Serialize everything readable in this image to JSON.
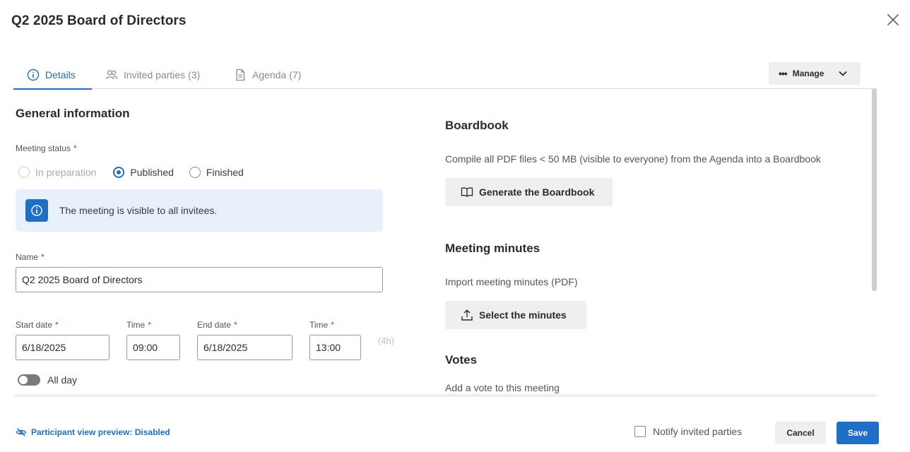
{
  "dialog": {
    "title": "Q2 2025 Board of Directors"
  },
  "tabs": [
    {
      "label": "Details",
      "icon": "info-icon",
      "active": true
    },
    {
      "label": "Invited parties (3)",
      "icon": "people-icon",
      "active": false
    },
    {
      "label": "Agenda (7)",
      "icon": "document-icon",
      "active": false
    }
  ],
  "manage": {
    "label": "Manage"
  },
  "general": {
    "heading": "General information",
    "status_label": "Meeting status",
    "required_mark": "*",
    "status_options": [
      {
        "label": "In preparation",
        "state": "disabled"
      },
      {
        "label": "Published",
        "state": "checked"
      },
      {
        "label": "Finished",
        "state": "unchecked"
      }
    ],
    "info_message": "The meeting is visible to all invitees.",
    "name_label": "Name",
    "name_value": "Q2 2025 Board of Directors",
    "start_date_label": "Start date",
    "start_date_value": "6/18/2025",
    "start_time_label": "Time",
    "start_time_value": "09:00",
    "end_date_label": "End date",
    "end_date_value": "6/18/2025",
    "end_time_label": "Time",
    "end_time_value": "13:00",
    "duration": "(4h)",
    "all_day_label": "All day",
    "all_day_on": false
  },
  "boardbook": {
    "heading": "Boardbook",
    "description": "Compile all PDF files < 50 MB (visible to everyone) from the Agenda into a Boardbook",
    "button_label": "Generate the Boardbook"
  },
  "minutes": {
    "heading": "Meeting minutes",
    "description": "Import meeting minutes (PDF)",
    "button_label": "Select the minutes"
  },
  "votes": {
    "heading": "Votes",
    "description": "Add a vote to this meeting"
  },
  "footer": {
    "preview_label": "Participant view preview: Disabled",
    "notify_label": "Notify invited parties",
    "cancel_label": "Cancel",
    "save_label": "Save"
  },
  "colors": {
    "accent": "#1f6fc5",
    "required": "#d0342c",
    "info_bg": "#e8f0fb",
    "button_gray": "#efefef"
  }
}
